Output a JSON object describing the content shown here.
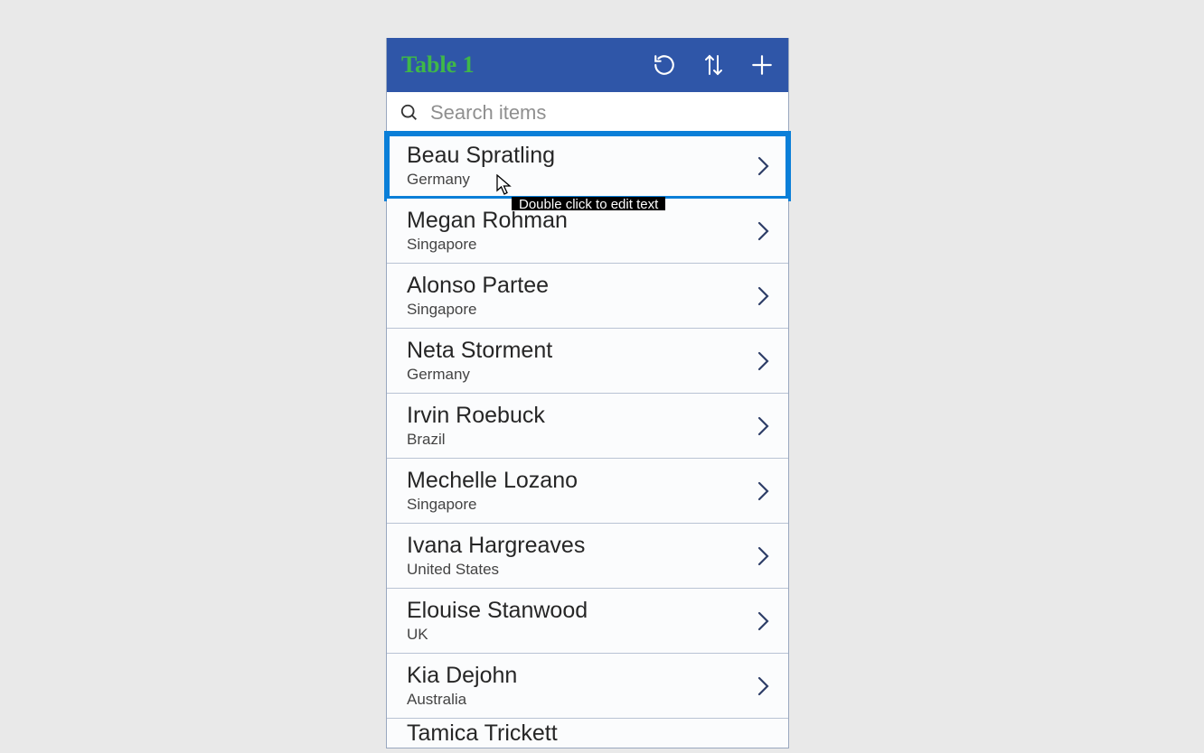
{
  "header": {
    "title": "Table 1"
  },
  "search": {
    "placeholder": "Search items",
    "value": ""
  },
  "tooltip": {
    "text": "Double click to edit text"
  },
  "list": {
    "selected_index": 0,
    "items": [
      {
        "name": "Beau Spratling",
        "country": "Germany"
      },
      {
        "name": "Megan Rohman",
        "country": "Singapore"
      },
      {
        "name": "Alonso Partee",
        "country": "Singapore"
      },
      {
        "name": "Neta Storment",
        "country": "Germany"
      },
      {
        "name": "Irvin Roebuck",
        "country": "Brazil"
      },
      {
        "name": "Mechelle Lozano",
        "country": "Singapore"
      },
      {
        "name": "Ivana Hargreaves",
        "country": "United States"
      },
      {
        "name": "Elouise Stanwood",
        "country": "UK"
      },
      {
        "name": "Kia Dejohn",
        "country": "Australia"
      },
      {
        "name": "Tamica Trickett",
        "country": ""
      }
    ]
  }
}
